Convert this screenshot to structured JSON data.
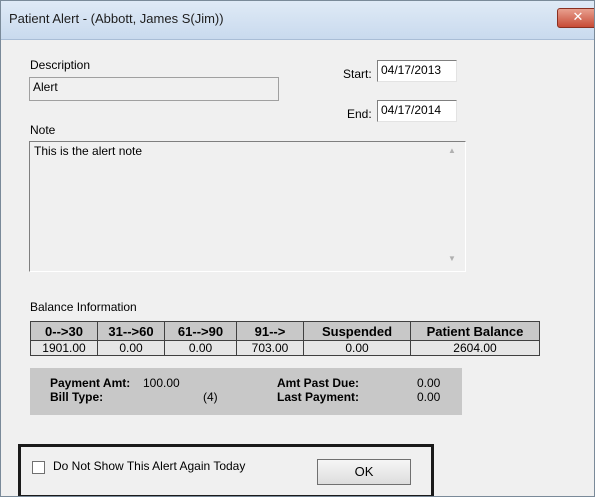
{
  "window": {
    "title": "Patient Alert - (Abbott, James S(Jim))",
    "close_glyph": "✕"
  },
  "description": {
    "label": "Description",
    "value": "Alert"
  },
  "start": {
    "label": "Start:",
    "value": "04/17/2013"
  },
  "end": {
    "label": "End:",
    "value": "04/17/2014"
  },
  "note": {
    "label": "Note",
    "value": "This is the alert note"
  },
  "balance": {
    "label": "Balance Information",
    "headers": [
      "0-->30",
      "31-->60",
      "61-->90",
      "91-->",
      "Suspended",
      "Patient Balance"
    ],
    "values": [
      "1901.00",
      "0.00",
      "0.00",
      "703.00",
      "0.00",
      "2604.00"
    ]
  },
  "payment": {
    "payment_amt_label": "Payment Amt:",
    "payment_amt_value": "100.00",
    "bill_type_label": "Bill Type:",
    "bill_type_value": "(4)",
    "amt_past_due_label": "Amt Past Due:",
    "amt_past_due_value": "0.00",
    "last_payment_label": "Last Payment:",
    "last_payment_value": "0.00"
  },
  "footer": {
    "checkbox_label": "Do Not Show This Alert Again Today",
    "checkbox_checked": false,
    "ok_label": "OK"
  }
}
